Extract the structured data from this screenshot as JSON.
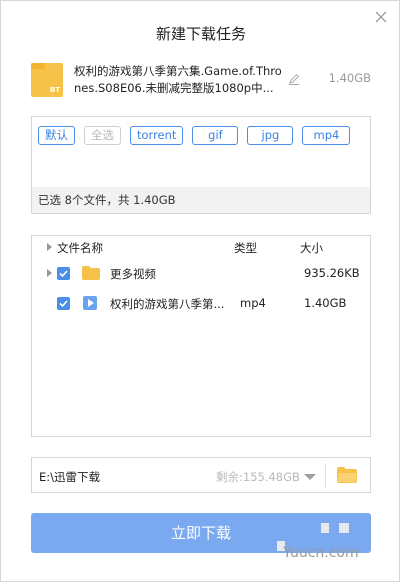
{
  "dialog": {
    "title": "新建下载任务"
  },
  "task": {
    "name": "权利的游戏第八季第六集.Game.of.Thrones.S08E06.未删减完整版1080p中...",
    "size": "1.40GB",
    "badge": "BT"
  },
  "filters": {
    "tags": [
      {
        "label": "默认",
        "enabled": true
      },
      {
        "label": "全选",
        "enabled": false
      },
      {
        "label": "torrent",
        "enabled": true
      },
      {
        "label": "gif",
        "enabled": true
      },
      {
        "label": "jpg",
        "enabled": true
      },
      {
        "label": "mp4",
        "enabled": true
      }
    ],
    "summary": "已选 8个文件，共 1.40GB"
  },
  "file_list": {
    "headers": {
      "name": "文件名称",
      "type": "类型",
      "size": "大小"
    },
    "rows": [
      {
        "name": "更多视频",
        "type": "",
        "size": "935.26KB",
        "kind": "folder",
        "checked": true
      },
      {
        "name": "权利的游戏第八季第...",
        "type": "mp4",
        "size": "1.40GB",
        "kind": "video",
        "checked": true
      }
    ]
  },
  "save_path": {
    "path": "E:\\迅雷下载",
    "free_space": "剩余:155.48GB"
  },
  "actions": {
    "download_label": "立即下载"
  },
  "watermark": {
    "text": "Yuucn.com"
  },
  "colors": {
    "accent": "#4a8ee8",
    "button": "#7ba9ef",
    "folder": "#f6c24a"
  }
}
